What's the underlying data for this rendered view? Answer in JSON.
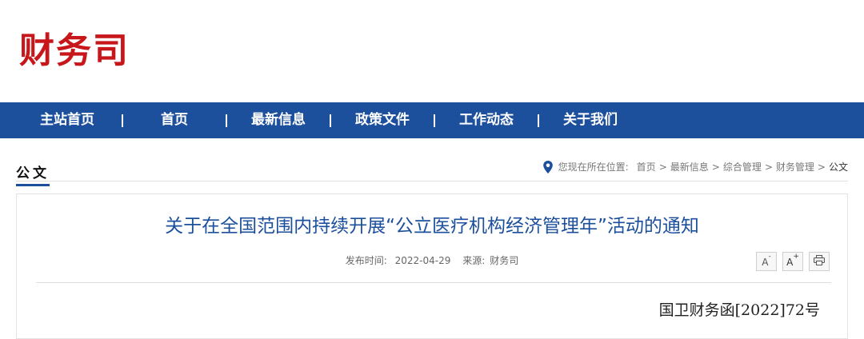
{
  "site": {
    "logo_text": "财务司",
    "logo_color": "#c8171b"
  },
  "nav": {
    "bg_color": "#1c4f9c",
    "items": [
      {
        "label": "主站首页"
      },
      {
        "label": "首页"
      },
      {
        "label": "最新信息"
      },
      {
        "label": "政策文件"
      },
      {
        "label": "工作动态"
      },
      {
        "label": "关于我们"
      }
    ]
  },
  "section": {
    "title": "公文"
  },
  "breadcrumb": {
    "prefix": "您现在所在位置:",
    "items": [
      "首页",
      "最新信息",
      "综合管理",
      "财务管理"
    ],
    "current": "公文",
    "separator": ">"
  },
  "article": {
    "title": "关于在全国范围内持续开展“公立医疗机构经济管理年”活动的通知",
    "publish_label": "发布时间:",
    "publish_date": "2022-04-29",
    "source_label": "来源:",
    "source": "财务司",
    "doc_number": "国卫财务函[2022]72号",
    "tools": [
      {
        "name": "font-decrease",
        "glyph": "A",
        "mark": "-"
      },
      {
        "name": "font-increase",
        "glyph": "A",
        "mark": "+"
      },
      {
        "name": "print",
        "glyph": "print-icon"
      }
    ]
  }
}
